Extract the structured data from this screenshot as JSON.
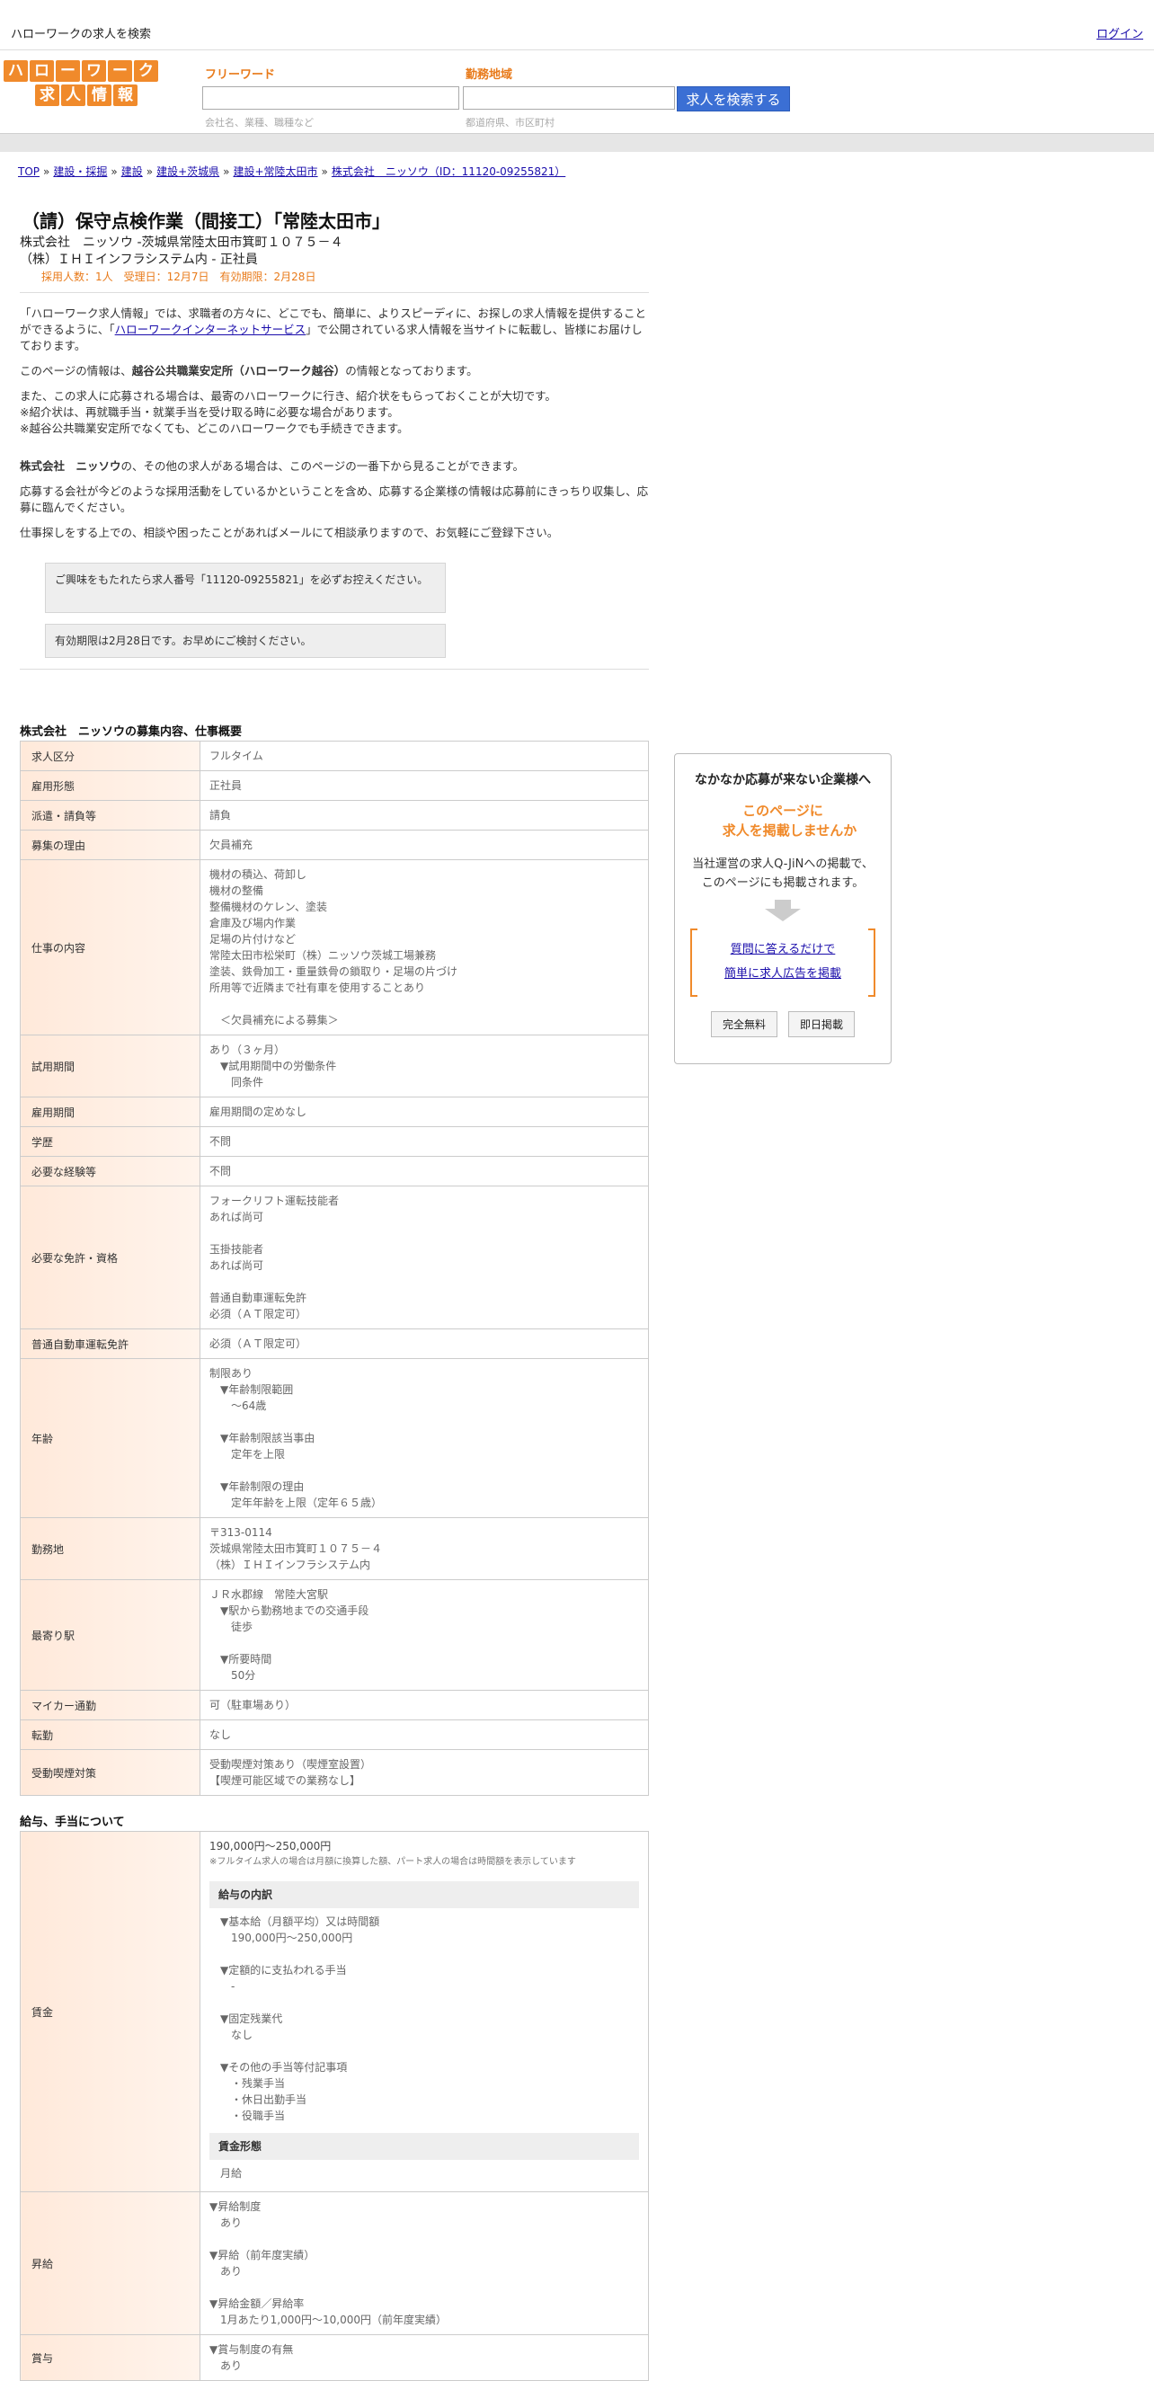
{
  "topbar": {
    "site_title": "ハローワークの求人を検索",
    "login": "ログイン"
  },
  "logo": {
    "row1": [
      "ハ",
      "ロ",
      "ー",
      "ワ",
      "ー",
      "ク"
    ],
    "row2": [
      "求",
      "人",
      "情",
      "報"
    ]
  },
  "search": {
    "freeword_label": "フリーワード",
    "freeword_placeholder": "会社名、業種、職種など",
    "area_label": "勤務地域",
    "area_placeholder": "都道府県、市区町村",
    "button": "求人を検索する"
  },
  "breadcrumb": [
    "TOP",
    "建設・採掘",
    "建設",
    "建設+茨城県",
    "建設+常陸太田市",
    "株式会社　ニッソウ（ID：11120-09255821）"
  ],
  "job": {
    "title": "（請）保守点検作業（間接工）「常陸太田市」",
    "company_line1": "株式会社　ニッソウ -茨城県常陸太田市箕町１０７５－４",
    "company_line2": "（株）ＩＨＩインフラシステム内 - 正社員",
    "meta": "採用人数：1人　受理日：12月7日　有効期限：2月28日"
  },
  "intro": {
    "p1_a": "「ハローワーク求人情報」では、求職者の方々に、どこでも、簡単に、よりスピーディに、お探しの求人情報を提供することができるように、「",
    "p1_link": "ハローワークインターネットサービス",
    "p1_b": "」で公開されている求人情報を当サイトに転載し、皆様にお届けしております。",
    "p2_a": "このページの情報は、",
    "p2_bold": "越谷公共職業安定所（ハローワーク越谷）",
    "p2_b": "の情報となっております。",
    "p3_1": "また、この求人に応募される場合は、最寄のハローワークに行き、紹介状をもらっておくことが大切です。",
    "p3_2": "※紹介状は、再就職手当・就業手当を受け取る時に必要な場合があります。",
    "p3_3": "※越谷公共職業安定所でなくても、どこのハローワークでも手続きできます。",
    "p4_bold": "株式会社　ニッソウ",
    "p4_b": "の、その他の求人がある場合は、このページの一番下から見ることができます。",
    "p5": "応募する会社が今どのような採用活動をしているかということを含め、応募する企業様の情報は応募前にきっちり収集し、応募に臨んでください。",
    "p6": "仕事探しをする上での、相談や困ったことがあればメールにて相談承りますので、お気軽にご登録下さい。"
  },
  "notices": {
    "n1": "ご興味をもたれたら求人番号「11120-09255821」を必ずお控えください。",
    "n2": "有効期限は2月28日です。お早めにご検討ください。"
  },
  "section1_title": "株式会社　ニッソウの募集内容、仕事概要",
  "rows": [
    {
      "k": "求人区分",
      "v": "フルタイム"
    },
    {
      "k": "雇用形態",
      "v": "正社員"
    },
    {
      "k": "派遣・請負等",
      "v": "請負"
    },
    {
      "k": "募集の理由",
      "v": "欠員補充"
    },
    {
      "k": "仕事の内容",
      "v": "機材の積込、荷卸し\n機材の整備\n整備機材のケレン、塗装\n倉庫及び場内作業\n足場の片付けなど\n常陸太田市松栄町（株）ニッソウ茨城工場兼務\n塗装、鉄骨加工・重量鉄骨の鎖取り・足場の片づけ\n所用等で近隣まで社有車を使用することあり\n\n　＜欠員補充による募集＞"
    },
    {
      "k": "試用期間",
      "v": "あり（３ヶ月）\n　▼試用期間中の労働条件\n　　同条件"
    },
    {
      "k": "雇用期間",
      "v": "雇用期間の定めなし"
    },
    {
      "k": "学歴",
      "v": "不問"
    },
    {
      "k": "必要な経験等",
      "v": "不問"
    },
    {
      "k": "必要な免許・資格",
      "v": "フォークリフト運転技能者\nあれば尚可\n\n玉掛技能者\nあれば尚可\n\n普通自動車運転免許\n必須（ＡＴ限定可）\n"
    },
    {
      "k": "普通自動車運転免許",
      "v": "必須（ＡＴ限定可）"
    },
    {
      "k": "年齢",
      "v": "制限あり\n　▼年齢制限範囲\n　　〜64歳\n\n　▼年齢制限該当事由\n　　定年を上限\n\n　▼年齢制限の理由\n　　定年年齢を上限（定年６５歳）"
    },
    {
      "k": "勤務地",
      "v": "〒313-0114\n茨城県常陸太田市箕町１０７５－４\n（株）ＩＨＩインフラシステム内"
    },
    {
      "k": "最寄り駅",
      "v": "ＪＲ水郡線　常陸大宮駅\n　▼駅から勤務地までの交通手段\n　　徒歩\n\n　▼所要時間\n　　50分"
    },
    {
      "k": "マイカー通勤",
      "v": "可（駐車場あり）"
    },
    {
      "k": "転勤",
      "v": "なし"
    },
    {
      "k": "受動喫煙対策",
      "v": "受動喫煙対策あり（喫煙室設置）\n【喫煙可能区域での業務なし】"
    }
  ],
  "section2_title": "給与、手当について",
  "wage": {
    "k": "賃金",
    "range": "190,000円〜250,000円",
    "note": "※フルタイム求人の場合は月額に換算した額、パート求人の場合は時間額を表示しています",
    "breakdown_head": "給与の内訳",
    "breakdown": "　▼基本給（月額平均）又は時間額\n　　190,000円〜250,000円\n\n　▼定額的に支払われる手当\n　　-\n\n　▼固定残業代\n　　なし\n\n　▼その他の手当等付記事項\n　　・残業手当\n　　・休日出勤手当\n　　・役職手当",
    "form_head": "賃金形態",
    "form": "　月給"
  },
  "raise": {
    "k": "昇給",
    "v": "▼昇給制度\n　あり\n\n▼昇給（前年度実績）\n　あり\n\n▼昇給金額／昇給率\n　1月あたり1,000円〜10,000円（前年度実績）"
  },
  "bonus": {
    "k": "賞与",
    "v": "▼賞与制度の有無\n　あり"
  },
  "side": {
    "heading": "なかなか応募が来ない企業様へ",
    "orange1": "このページに",
    "orange2": "　求人を掲載しませんか",
    "desc1": "当社運営の求人Q-JiNへの掲載で、",
    "desc2": "このページにも掲載されます。",
    "link1": "質問に答えるだけで",
    "link2": "簡単に求人広告を掲載",
    "btn1": "完全無料",
    "btn2": "即日掲載"
  }
}
